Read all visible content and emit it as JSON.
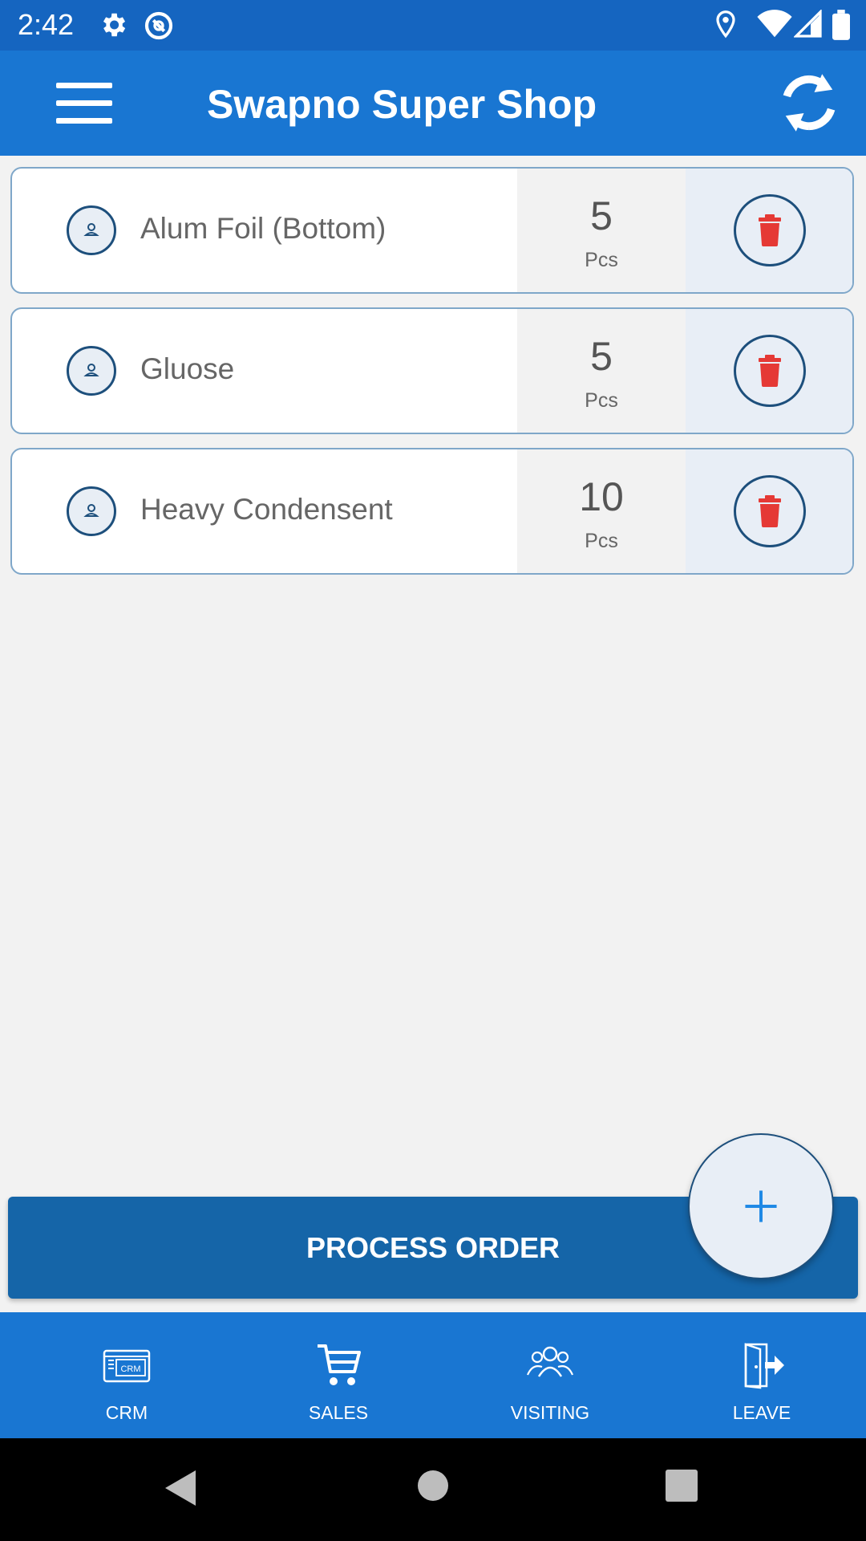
{
  "status_bar": {
    "time": "2:42"
  },
  "app_bar": {
    "title": "Swapno Super Shop"
  },
  "items": [
    {
      "name": "Alum Foil (Bottom)",
      "qty": "5",
      "unit": "Pcs"
    },
    {
      "name": "Gluose",
      "qty": "5",
      "unit": "Pcs"
    },
    {
      "name": "Heavy Condensent",
      "qty": "10",
      "unit": "Pcs"
    }
  ],
  "actions": {
    "process_order": "PROCESS ORDER",
    "add": "+"
  },
  "bottom_nav": [
    {
      "label": "CRM",
      "icon": "crm-icon"
    },
    {
      "label": "SALES",
      "icon": "cart-icon"
    },
    {
      "label": "VISITING",
      "icon": "people-icon"
    },
    {
      "label": "LEAVE",
      "icon": "exit-icon"
    }
  ],
  "colors": {
    "primary": "#1976d2",
    "status": "#1565c0",
    "button": "#1565a8",
    "delete": "#e53935",
    "outline": "#1d4f7c"
  }
}
